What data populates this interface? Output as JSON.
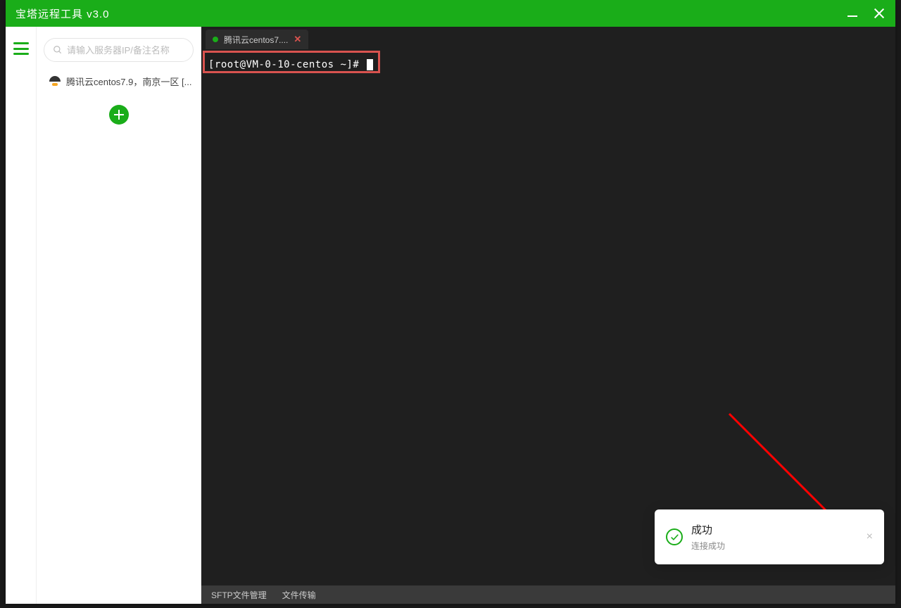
{
  "titlebar": {
    "title": "宝塔远程工具 v3.0"
  },
  "sidebar": {
    "search_placeholder": "请输入服务器IP/备注名称",
    "server_label": "腾讯云centos7.9，南京一区 [..."
  },
  "tab": {
    "label": "腾讯云centos7....",
    "close_glyph": "✕"
  },
  "terminal": {
    "prompt": "[root@VM-0-10-centos ~]# "
  },
  "statusbar": {
    "sftp_label": "SFTP文件管理",
    "file_transfer_label": "文件传输"
  },
  "toast": {
    "title": "成功",
    "subtitle": "连接成功",
    "close_glyph": "×"
  }
}
